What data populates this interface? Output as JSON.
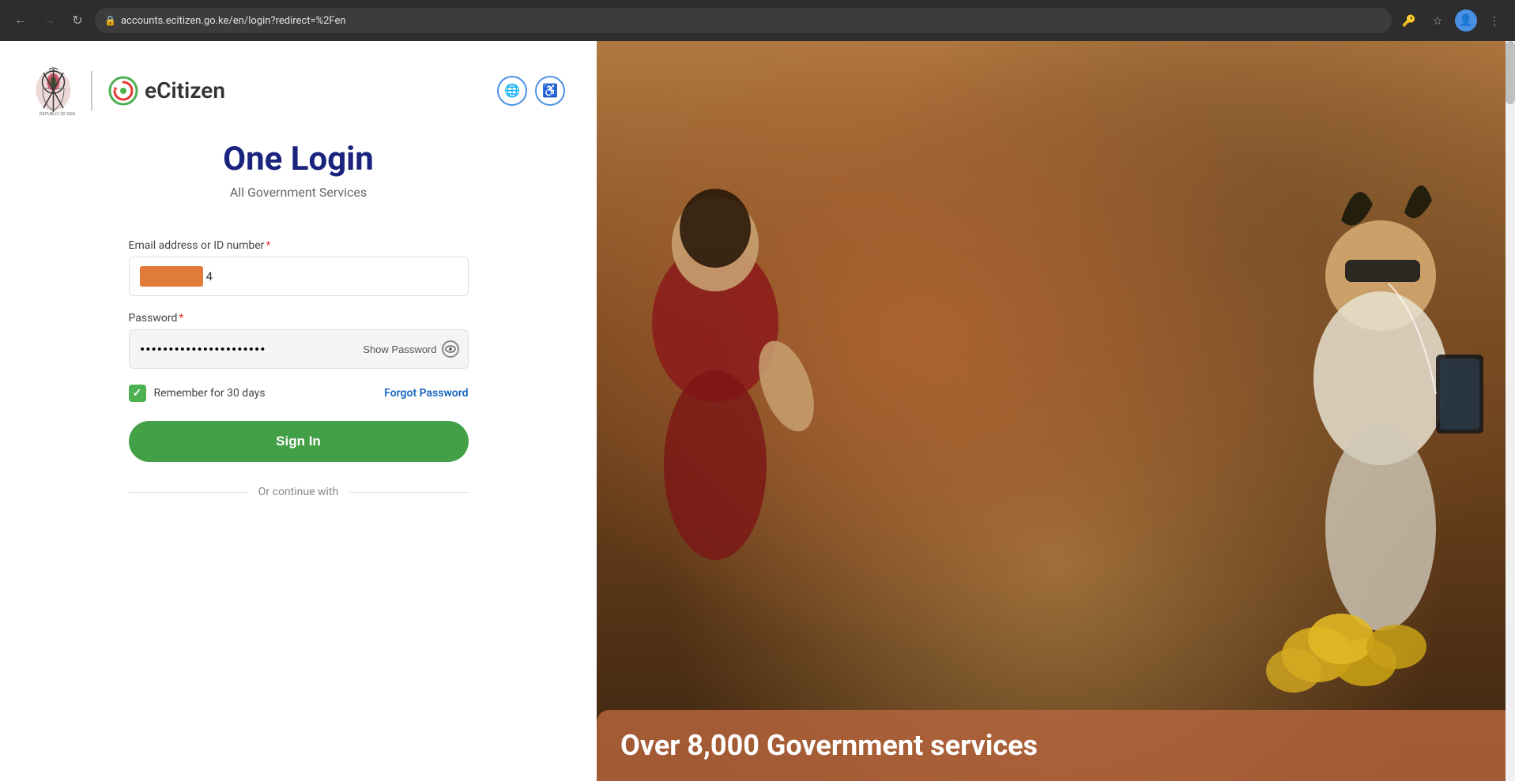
{
  "browser": {
    "url": "accounts.ecitizen.go.ke/en/login?redirect=%2Fen",
    "back_disabled": false,
    "forward_disabled": true
  },
  "header": {
    "logo_text": "eCitizen",
    "subtitle": "REPUBLIC OF KENYA"
  },
  "page": {
    "title": "One Login",
    "subtitle": "All Government Services"
  },
  "form": {
    "email_label": "Email address or ID number",
    "email_required": "*",
    "email_value": "4",
    "email_placeholder": "",
    "password_label": "Password",
    "password_required": "*",
    "password_value": "••••••••••••••••",
    "show_password_label": "Show Password",
    "remember_label": "Remember for 30 days",
    "forgot_password_label": "Forgot Password",
    "sign_in_label": "Sign In",
    "or_continue_label": "Or continue with"
  },
  "icons": {
    "globe": "🌐",
    "accessibility": "♿",
    "eye": "👁",
    "check": "✓",
    "back_arrow": "←",
    "forward_arrow": "→",
    "reload": "↻",
    "lock": "🔒",
    "star": "☆",
    "more": "⋮",
    "key": "🔑",
    "profile": "👤"
  },
  "right_panel": {
    "overlay_text_prefix": "Over ",
    "overlay_number": "8,000",
    "overlay_text_suffix": " Government services"
  }
}
